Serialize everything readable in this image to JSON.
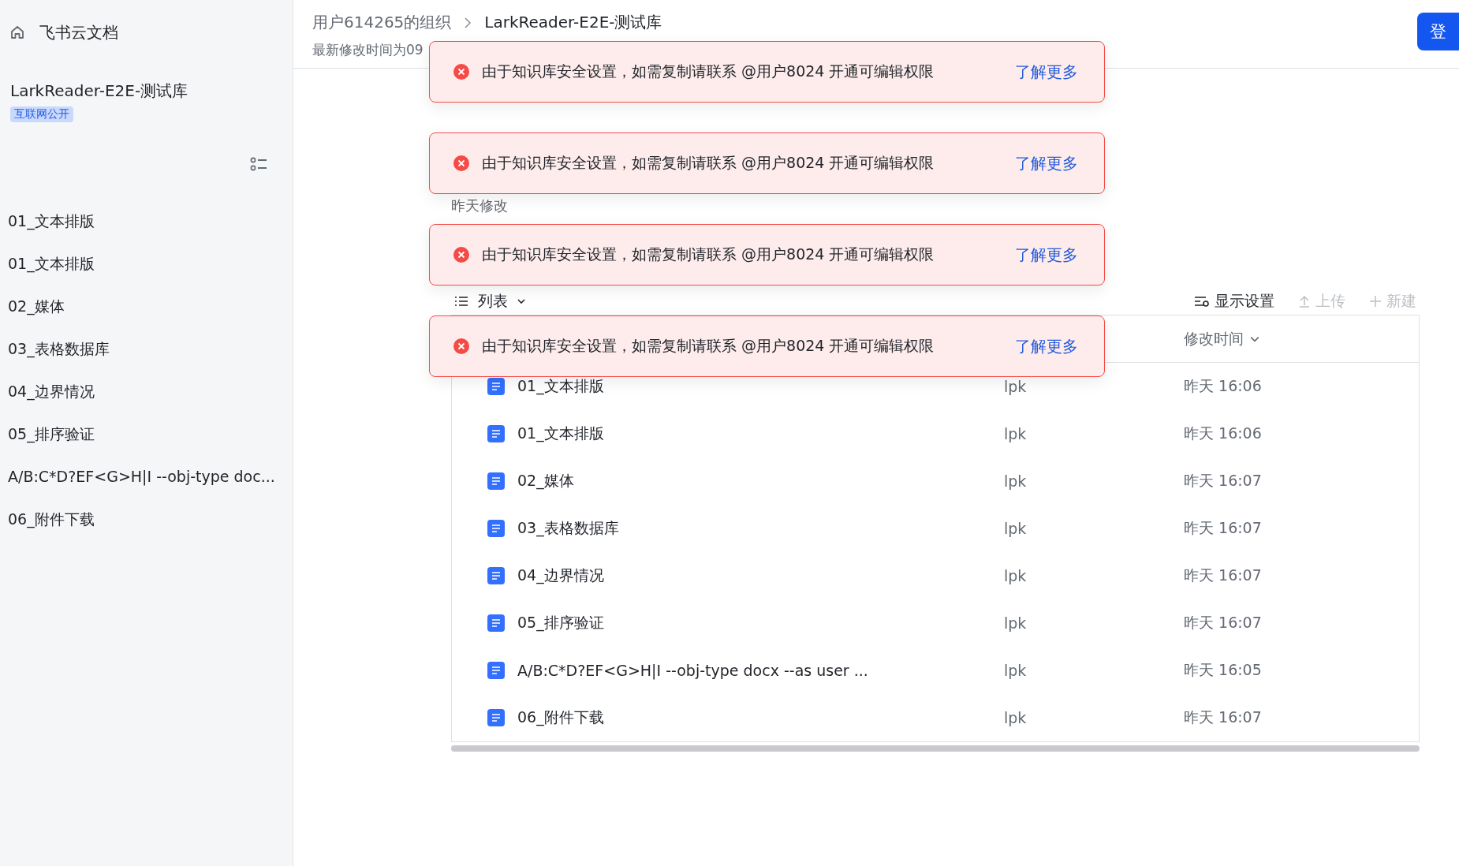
{
  "sidebar": {
    "home_label": "飞书云文档",
    "space_title": "LarkReader-E2E-测试库",
    "space_badge": "互联网公开",
    "items": [
      {
        "label": "01_文本排版",
        "selected": false
      },
      {
        "label": "01_文本排版",
        "selected": false
      },
      {
        "label": "02_媒体",
        "selected": false
      },
      {
        "label": "03_表格数据库",
        "selected": false
      },
      {
        "label": "04_边界情况",
        "selected": false
      },
      {
        "label": "05_排序验证",
        "selected": false
      },
      {
        "label": "A/B:C*D?EF<G>H|I --obj-type doc...",
        "selected": false
      },
      {
        "label": "06_附件下载",
        "selected": false
      }
    ]
  },
  "header": {
    "breadcrumb": [
      "用户614265的组织",
      "LarkReader-E2E-测试库"
    ],
    "modified_note": "最新修改时间为09",
    "login_button": "登"
  },
  "section_title": "昨天修改",
  "view_switch": {
    "label": "列表",
    "expanded": false
  },
  "toolbar": [
    {
      "label": "显示设置",
      "disabled": false,
      "kind": "settings"
    },
    {
      "label": "上传",
      "disabled": true,
      "kind": "upload"
    },
    {
      "label": "新建",
      "disabled": true,
      "kind": "new"
    }
  ],
  "table": {
    "sort_column": "修改时间",
    "rows": [
      {
        "name": "01_文本排版",
        "owner": "lpk",
        "modified": "昨天 16:06"
      },
      {
        "name": "01_文本排版",
        "owner": "lpk",
        "modified": "昨天 16:06"
      },
      {
        "name": "02_媒体",
        "owner": "lpk",
        "modified": "昨天 16:07"
      },
      {
        "name": "03_表格数据库",
        "owner": "lpk",
        "modified": "昨天 16:07"
      },
      {
        "name": "04_边界情况",
        "owner": "lpk",
        "modified": "昨天 16:07"
      },
      {
        "name": "05_排序验证",
        "owner": "lpk",
        "modified": "昨天 16:07"
      },
      {
        "name": "A/B:C*D?EF<G>H|I --obj-type docx --as user ...",
        "owner": "lpk",
        "modified": "昨天 16:05"
      },
      {
        "name": "06_附件下载",
        "owner": "lpk",
        "modified": "昨天 16:07"
      }
    ]
  },
  "toasts": [
    {
      "message": "由于知识库安全设置，如需复制请联系 @用户8024 开通可编辑权限",
      "link": "了解更多"
    },
    {
      "message": "由于知识库安全设置，如需复制请联系 @用户8024 开通可编辑权限",
      "link": "了解更多"
    },
    {
      "message": "由于知识库安全设置，如需复制请联系 @用户8024 开通可编辑权限",
      "link": "了解更多"
    },
    {
      "message": "由于知识库安全设置，如需复制请联系 @用户8024 开通可编辑权限",
      "link": "了解更多"
    }
  ]
}
